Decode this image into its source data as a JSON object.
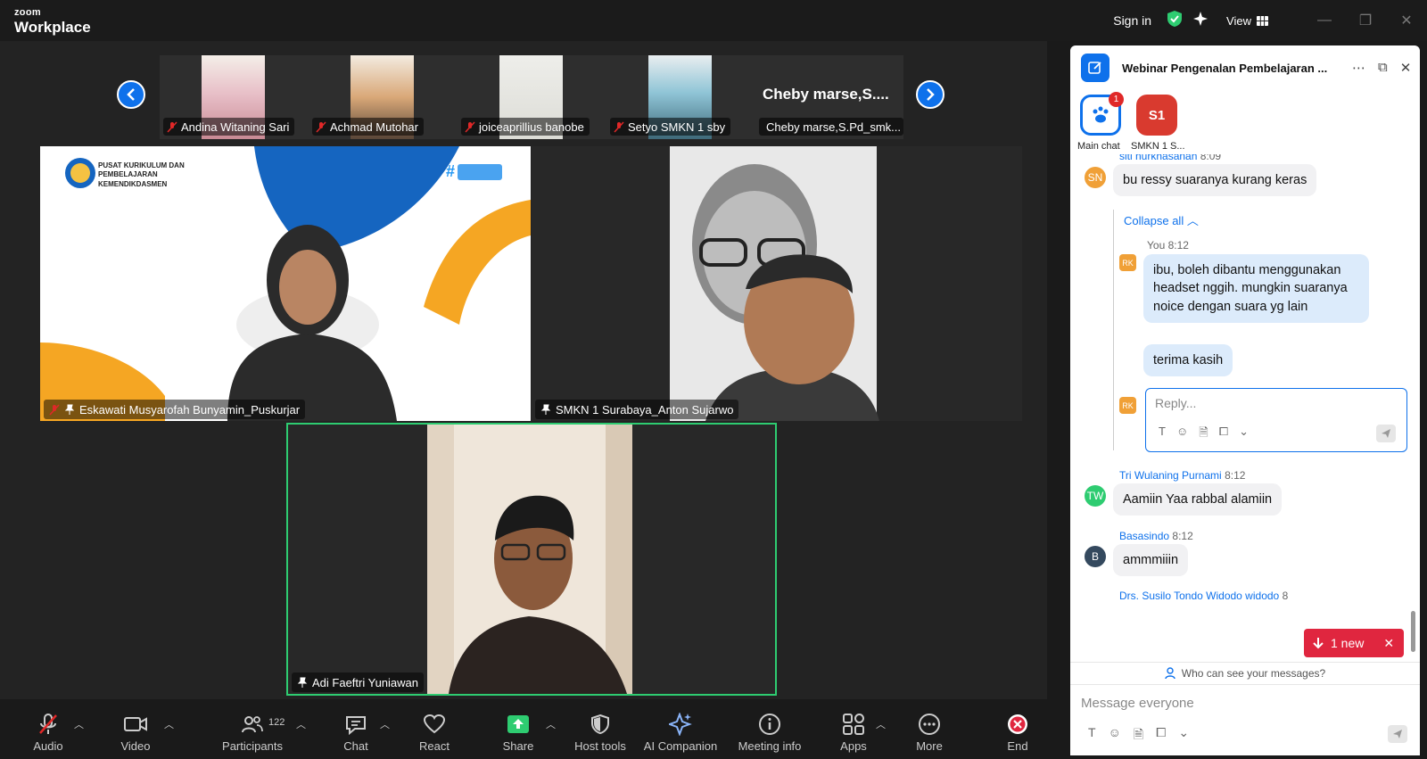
{
  "app": {
    "brand_top": "zoom",
    "brand_bottom": "Workplace"
  },
  "titlebar": {
    "sign_in": "Sign in",
    "view": "View"
  },
  "strip": {
    "thumbs": [
      {
        "name": "Andina Witaning Sari"
      },
      {
        "name": "Achmad Mutohar"
      },
      {
        "name": "joiceaprillius banobe"
      },
      {
        "name": "Setyo SMKN 1 sby"
      },
      {
        "name": "Cheby marse,S.Pd_smk...",
        "big": "Cheby  marse,S...."
      }
    ]
  },
  "tiles": {
    "t1": {
      "name": "Eskawati Musyarofah Bunyamin_Puskurjar",
      "banner1": "PUSAT KURIKULUM DAN",
      "banner2": "PEMBELAJARAN",
      "banner3": "KEMENDIKDASMEN"
    },
    "t2": {
      "name": "SMKN 1 Surabaya_Anton Sujarwo"
    },
    "t3": {
      "name": "Adi Faeftri Yuniawan"
    }
  },
  "toolbar": {
    "audio": "Audio",
    "video": "Video",
    "participants": "Participants",
    "participants_count": "122",
    "chat": "Chat",
    "react": "React",
    "share": "Share",
    "host_tools": "Host tools",
    "ai": "AI Companion",
    "meeting_info": "Meeting info",
    "apps": "Apps",
    "more": "More",
    "end": "End"
  },
  "chat": {
    "title": "Webinar Pengenalan Pembelajaran ...",
    "tab_main_label": "Main chat",
    "tab_main_badge": "1",
    "tab_s1": "S1",
    "tab_s1_label": "SMKN 1 S...",
    "messages": {
      "m0_sender": "siti nurkhasanah",
      "m0_time": "8:09",
      "m0_avatar": "SN",
      "m0_text": "bu ressy suaranya kurang keras",
      "collapse": "Collapse all",
      "me_sender": "You",
      "me_time": "8:12",
      "me_avatar": "RK",
      "me_text1": "ibu, boleh dibantu menggunakan headset nggih. mungkin suaranya noice dengan suara yg lain",
      "me_text2": "terima kasih",
      "reply_avatar": "RK",
      "reply_placeholder": "Reply...",
      "m1_sender": "Tri Wulaning Purnami",
      "m1_time": "8:12",
      "m1_avatar": "TW",
      "m1_text": "Aamiin Yaa rabbal alamiin",
      "m2_sender": "Basasindo",
      "m2_time": "8:12",
      "m2_avatar": "B",
      "m2_text": "ammmiiin",
      "m3_sender": "Drs. Susilo Tondo Widodo widodo",
      "m3_time": "8"
    },
    "new_pill": "1 new",
    "privacy": "Who can see your messages?",
    "compose_placeholder": "Message everyone"
  },
  "colors": {
    "accent": "#0e71eb",
    "active_speaker": "#2ecc71",
    "danger": "#e0263f",
    "mic_off": "#e02828"
  }
}
